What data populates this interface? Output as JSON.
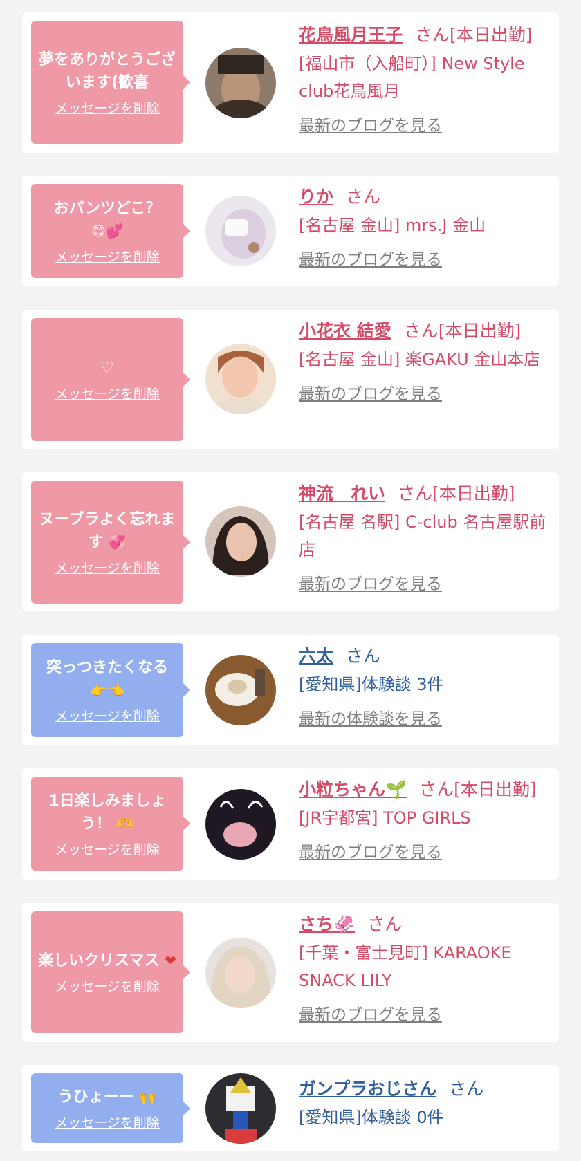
{
  "entries": [
    {
      "message": "夢をありがとうございます(歓喜",
      "delete_label": "メッセージを削除",
      "name": "花鳥風月王子",
      "suffix": "さん[本日出勤]",
      "shop": "[福山市（入船町）] New Style club花鳥風月",
      "link": "最新のブログを見る",
      "theme": "pink",
      "icon": "",
      "avatar_color": "#6a5b4f"
    },
    {
      "message": "おパンツどこ？",
      "delete_label": "メッセージを削除",
      "name": "りか",
      "suffix": "さん",
      "shop": "[名古屋 金山] mrs.J 金山",
      "link": "最新のブログを見る",
      "theme": "pink",
      "icon": "😋💕",
      "avatar_color": "#d9cfe6"
    },
    {
      "message": "♡",
      "delete_label": "メッセージを削除",
      "name": "小花衣 結愛",
      "suffix": "さん[本日出勤]",
      "shop": "[名古屋 金山] 楽GAKU 金山本店",
      "link": "最新のブログを見る",
      "theme": "pink",
      "icon": "",
      "avatar_color": "#e2b79a"
    },
    {
      "message": "ヌーブラよく忘れます",
      "delete_label": "メッセージを削除",
      "name": "神流　れい",
      "suffix": "さん[本日出勤]",
      "shop": "[名古屋 名駅] C-club 名古屋駅前店",
      "link": "最新のブログを見る",
      "theme": "pink",
      "icon": "💞",
      "avatar_color": "#4a3b36"
    },
    {
      "message": "突っつきたくなる",
      "delete_label": "メッセージを削除",
      "name": "六太",
      "suffix": "さん",
      "shop": "[愛知県]体験談 3件",
      "link": "最新の体験談を見る",
      "theme": "blue",
      "icon": "👉👈",
      "avatar_color": "#a67645"
    },
    {
      "message": "1日楽しみましょう！",
      "delete_label": "メッセージを削除",
      "name": "小粒ちゃん🌱",
      "suffix": "さん[本日出勤]",
      "shop": "[JR宇都宮] TOP GIRLS",
      "link": "最新のブログを見る",
      "theme": "pink",
      "icon": "🫶",
      "avatar_color": "#2c2230"
    },
    {
      "message": "楽しいクリスマス",
      "delete_label": "メッセージを削除",
      "name": "さち🦑",
      "suffix": "さん",
      "shop": "[千葉・富士見町] KARAOKE SNACK LILY",
      "link": "最新のブログを見る",
      "theme": "pink",
      "icon": "❤",
      "avatar_color": "#d8cfcb"
    },
    {
      "message": "うひょーー",
      "delete_label": "メッセージを削除",
      "name": "ガンプラおじさん",
      "suffix": "さん",
      "shop": "[愛知県]体験談 0件",
      "link": "",
      "theme": "blue",
      "icon": "🙌",
      "avatar_color": "#3b3a45"
    }
  ],
  "colors": {
    "pink_bubble": "#ef98a6",
    "blue_bubble": "#93aeee",
    "pink_text": "#d44a67",
    "blue_text": "#2f5f9c"
  }
}
